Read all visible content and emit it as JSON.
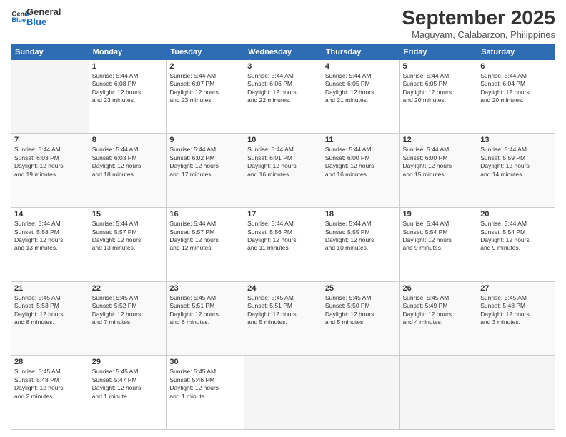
{
  "header": {
    "logo_line1": "General",
    "logo_line2": "Blue",
    "month_title": "September 2025",
    "subtitle": "Maguyam, Calabarzon, Philippines"
  },
  "weekdays": [
    "Sunday",
    "Monday",
    "Tuesday",
    "Wednesday",
    "Thursday",
    "Friday",
    "Saturday"
  ],
  "weeks": [
    [
      {
        "day": "",
        "info": ""
      },
      {
        "day": "1",
        "info": "Sunrise: 5:44 AM\nSunset: 6:08 PM\nDaylight: 12 hours\nand 23 minutes."
      },
      {
        "day": "2",
        "info": "Sunrise: 5:44 AM\nSunset: 6:07 PM\nDaylight: 12 hours\nand 23 minutes."
      },
      {
        "day": "3",
        "info": "Sunrise: 5:44 AM\nSunset: 6:06 PM\nDaylight: 12 hours\nand 22 minutes."
      },
      {
        "day": "4",
        "info": "Sunrise: 5:44 AM\nSunset: 6:05 PM\nDaylight: 12 hours\nand 21 minutes."
      },
      {
        "day": "5",
        "info": "Sunrise: 5:44 AM\nSunset: 6:05 PM\nDaylight: 12 hours\nand 20 minutes."
      },
      {
        "day": "6",
        "info": "Sunrise: 5:44 AM\nSunset: 6:04 PM\nDaylight: 12 hours\nand 20 minutes."
      }
    ],
    [
      {
        "day": "7",
        "info": "Sunrise: 5:44 AM\nSunset: 6:03 PM\nDaylight: 12 hours\nand 19 minutes."
      },
      {
        "day": "8",
        "info": "Sunrise: 5:44 AM\nSunset: 6:03 PM\nDaylight: 12 hours\nand 18 minutes."
      },
      {
        "day": "9",
        "info": "Sunrise: 5:44 AM\nSunset: 6:02 PM\nDaylight: 12 hours\nand 17 minutes."
      },
      {
        "day": "10",
        "info": "Sunrise: 5:44 AM\nSunset: 6:01 PM\nDaylight: 12 hours\nand 16 minutes."
      },
      {
        "day": "11",
        "info": "Sunrise: 5:44 AM\nSunset: 6:00 PM\nDaylight: 12 hours\nand 16 minutes."
      },
      {
        "day": "12",
        "info": "Sunrise: 5:44 AM\nSunset: 6:00 PM\nDaylight: 12 hours\nand 15 minutes."
      },
      {
        "day": "13",
        "info": "Sunrise: 5:44 AM\nSunset: 5:59 PM\nDaylight: 12 hours\nand 14 minutes."
      }
    ],
    [
      {
        "day": "14",
        "info": "Sunrise: 5:44 AM\nSunset: 5:58 PM\nDaylight: 12 hours\nand 13 minutes."
      },
      {
        "day": "15",
        "info": "Sunrise: 5:44 AM\nSunset: 5:57 PM\nDaylight: 12 hours\nand 13 minutes."
      },
      {
        "day": "16",
        "info": "Sunrise: 5:44 AM\nSunset: 5:57 PM\nDaylight: 12 hours\nand 12 minutes."
      },
      {
        "day": "17",
        "info": "Sunrise: 5:44 AM\nSunset: 5:56 PM\nDaylight: 12 hours\nand 11 minutes."
      },
      {
        "day": "18",
        "info": "Sunrise: 5:44 AM\nSunset: 5:55 PM\nDaylight: 12 hours\nand 10 minutes."
      },
      {
        "day": "19",
        "info": "Sunrise: 5:44 AM\nSunset: 5:54 PM\nDaylight: 12 hours\nand 9 minutes."
      },
      {
        "day": "20",
        "info": "Sunrise: 5:44 AM\nSunset: 5:54 PM\nDaylight: 12 hours\nand 9 minutes."
      }
    ],
    [
      {
        "day": "21",
        "info": "Sunrise: 5:45 AM\nSunset: 5:53 PM\nDaylight: 12 hours\nand 8 minutes."
      },
      {
        "day": "22",
        "info": "Sunrise: 5:45 AM\nSunset: 5:52 PM\nDaylight: 12 hours\nand 7 minutes."
      },
      {
        "day": "23",
        "info": "Sunrise: 5:45 AM\nSunset: 5:51 PM\nDaylight: 12 hours\nand 6 minutes."
      },
      {
        "day": "24",
        "info": "Sunrise: 5:45 AM\nSunset: 5:51 PM\nDaylight: 12 hours\nand 5 minutes."
      },
      {
        "day": "25",
        "info": "Sunrise: 5:45 AM\nSunset: 5:50 PM\nDaylight: 12 hours\nand 5 minutes."
      },
      {
        "day": "26",
        "info": "Sunrise: 5:45 AM\nSunset: 5:49 PM\nDaylight: 12 hours\nand 4 minutes."
      },
      {
        "day": "27",
        "info": "Sunrise: 5:45 AM\nSunset: 5:48 PM\nDaylight: 12 hours\nand 3 minutes."
      }
    ],
    [
      {
        "day": "28",
        "info": "Sunrise: 5:45 AM\nSunset: 5:48 PM\nDaylight: 12 hours\nand 2 minutes."
      },
      {
        "day": "29",
        "info": "Sunrise: 5:45 AM\nSunset: 5:47 PM\nDaylight: 12 hours\nand 1 minute."
      },
      {
        "day": "30",
        "info": "Sunrise: 5:45 AM\nSunset: 5:46 PM\nDaylight: 12 hours\nand 1 minute."
      },
      {
        "day": "",
        "info": ""
      },
      {
        "day": "",
        "info": ""
      },
      {
        "day": "",
        "info": ""
      },
      {
        "day": "",
        "info": ""
      }
    ]
  ]
}
